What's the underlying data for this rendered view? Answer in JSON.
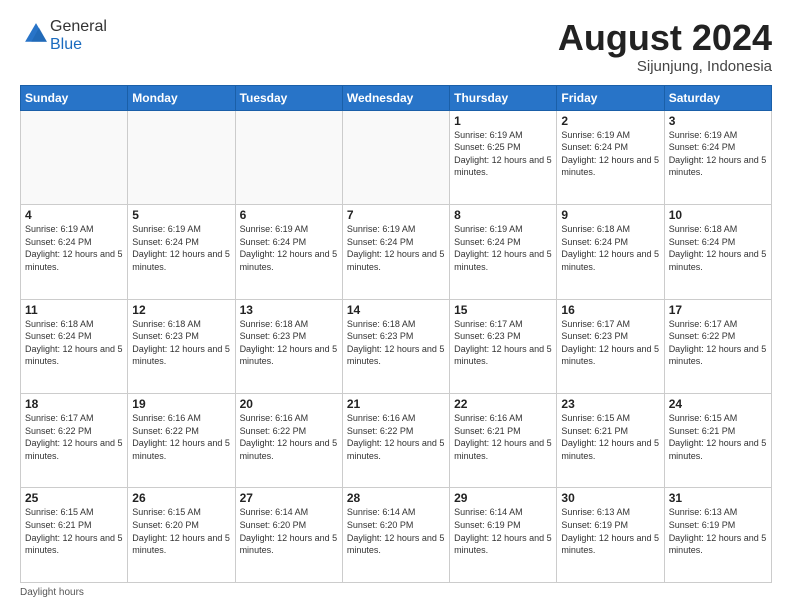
{
  "header": {
    "logo_general": "General",
    "logo_blue": "Blue",
    "month_title": "August 2024",
    "subtitle": "Sijunjung, Indonesia"
  },
  "days_of_week": [
    "Sunday",
    "Monday",
    "Tuesday",
    "Wednesday",
    "Thursday",
    "Friday",
    "Saturday"
  ],
  "footer": {
    "daylight_label": "Daylight hours"
  },
  "weeks": [
    [
      {
        "day": "",
        "empty": true
      },
      {
        "day": "",
        "empty": true
      },
      {
        "day": "",
        "empty": true
      },
      {
        "day": "",
        "empty": true
      },
      {
        "day": "1",
        "sunrise": "6:19 AM",
        "sunset": "6:25 PM",
        "daylight": "12 hours and 5 minutes."
      },
      {
        "day": "2",
        "sunrise": "6:19 AM",
        "sunset": "6:24 PM",
        "daylight": "12 hours and 5 minutes."
      },
      {
        "day": "3",
        "sunrise": "6:19 AM",
        "sunset": "6:24 PM",
        "daylight": "12 hours and 5 minutes."
      }
    ],
    [
      {
        "day": "4",
        "sunrise": "6:19 AM",
        "sunset": "6:24 PM",
        "daylight": "12 hours and 5 minutes."
      },
      {
        "day": "5",
        "sunrise": "6:19 AM",
        "sunset": "6:24 PM",
        "daylight": "12 hours and 5 minutes."
      },
      {
        "day": "6",
        "sunrise": "6:19 AM",
        "sunset": "6:24 PM",
        "daylight": "12 hours and 5 minutes."
      },
      {
        "day": "7",
        "sunrise": "6:19 AM",
        "sunset": "6:24 PM",
        "daylight": "12 hours and 5 minutes."
      },
      {
        "day": "8",
        "sunrise": "6:19 AM",
        "sunset": "6:24 PM",
        "daylight": "12 hours and 5 minutes."
      },
      {
        "day": "9",
        "sunrise": "6:18 AM",
        "sunset": "6:24 PM",
        "daylight": "12 hours and 5 minutes."
      },
      {
        "day": "10",
        "sunrise": "6:18 AM",
        "sunset": "6:24 PM",
        "daylight": "12 hours and 5 minutes."
      }
    ],
    [
      {
        "day": "11",
        "sunrise": "6:18 AM",
        "sunset": "6:24 PM",
        "daylight": "12 hours and 5 minutes."
      },
      {
        "day": "12",
        "sunrise": "6:18 AM",
        "sunset": "6:23 PM",
        "daylight": "12 hours and 5 minutes."
      },
      {
        "day": "13",
        "sunrise": "6:18 AM",
        "sunset": "6:23 PM",
        "daylight": "12 hours and 5 minutes."
      },
      {
        "day": "14",
        "sunrise": "6:18 AM",
        "sunset": "6:23 PM",
        "daylight": "12 hours and 5 minutes."
      },
      {
        "day": "15",
        "sunrise": "6:17 AM",
        "sunset": "6:23 PM",
        "daylight": "12 hours and 5 minutes."
      },
      {
        "day": "16",
        "sunrise": "6:17 AM",
        "sunset": "6:23 PM",
        "daylight": "12 hours and 5 minutes."
      },
      {
        "day": "17",
        "sunrise": "6:17 AM",
        "sunset": "6:22 PM",
        "daylight": "12 hours and 5 minutes."
      }
    ],
    [
      {
        "day": "18",
        "sunrise": "6:17 AM",
        "sunset": "6:22 PM",
        "daylight": "12 hours and 5 minutes."
      },
      {
        "day": "19",
        "sunrise": "6:16 AM",
        "sunset": "6:22 PM",
        "daylight": "12 hours and 5 minutes."
      },
      {
        "day": "20",
        "sunrise": "6:16 AM",
        "sunset": "6:22 PM",
        "daylight": "12 hours and 5 minutes."
      },
      {
        "day": "21",
        "sunrise": "6:16 AM",
        "sunset": "6:22 PM",
        "daylight": "12 hours and 5 minutes."
      },
      {
        "day": "22",
        "sunrise": "6:16 AM",
        "sunset": "6:21 PM",
        "daylight": "12 hours and 5 minutes."
      },
      {
        "day": "23",
        "sunrise": "6:15 AM",
        "sunset": "6:21 PM",
        "daylight": "12 hours and 5 minutes."
      },
      {
        "day": "24",
        "sunrise": "6:15 AM",
        "sunset": "6:21 PM",
        "daylight": "12 hours and 5 minutes."
      }
    ],
    [
      {
        "day": "25",
        "sunrise": "6:15 AM",
        "sunset": "6:21 PM",
        "daylight": "12 hours and 5 minutes."
      },
      {
        "day": "26",
        "sunrise": "6:15 AM",
        "sunset": "6:20 PM",
        "daylight": "12 hours and 5 minutes."
      },
      {
        "day": "27",
        "sunrise": "6:14 AM",
        "sunset": "6:20 PM",
        "daylight": "12 hours and 5 minutes."
      },
      {
        "day": "28",
        "sunrise": "6:14 AM",
        "sunset": "6:20 PM",
        "daylight": "12 hours and 5 minutes."
      },
      {
        "day": "29",
        "sunrise": "6:14 AM",
        "sunset": "6:19 PM",
        "daylight": "12 hours and 5 minutes."
      },
      {
        "day": "30",
        "sunrise": "6:13 AM",
        "sunset": "6:19 PM",
        "daylight": "12 hours and 5 minutes."
      },
      {
        "day": "31",
        "sunrise": "6:13 AM",
        "sunset": "6:19 PM",
        "daylight": "12 hours and 5 minutes."
      }
    ]
  ]
}
